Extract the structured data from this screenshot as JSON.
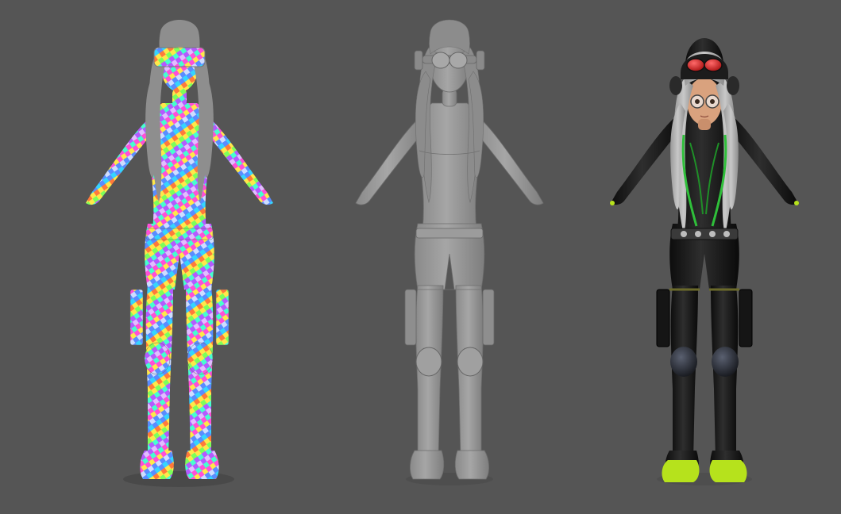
{
  "scene": {
    "background_color": "#555555",
    "figures": [
      {
        "id": "uv-checker",
        "description_name": "uv-checker-model",
        "material": "uv-checker-rainbow",
        "hair_color": "#8e8e8e"
      },
      {
        "id": "clay",
        "description_name": "clay-model",
        "material": "untextured-grey",
        "base_color": "#9a9a9a"
      },
      {
        "id": "textured",
        "description_name": "textured-model",
        "material": "final-textured",
        "suit_color": "#1a1a1a",
        "accent_color": "#2fbf3a",
        "shoe_color": "#b6e21c",
        "hair_color": "#b8b8b8",
        "skin_color": "#d9a27e"
      }
    ],
    "checker_colors": [
      "#ff4fd8",
      "#46ffcf",
      "#ffe84a",
      "#5a8cff",
      "#ff7a3a",
      "#7dff5a",
      "#b45aff",
      "#35d4ff"
    ]
  }
}
